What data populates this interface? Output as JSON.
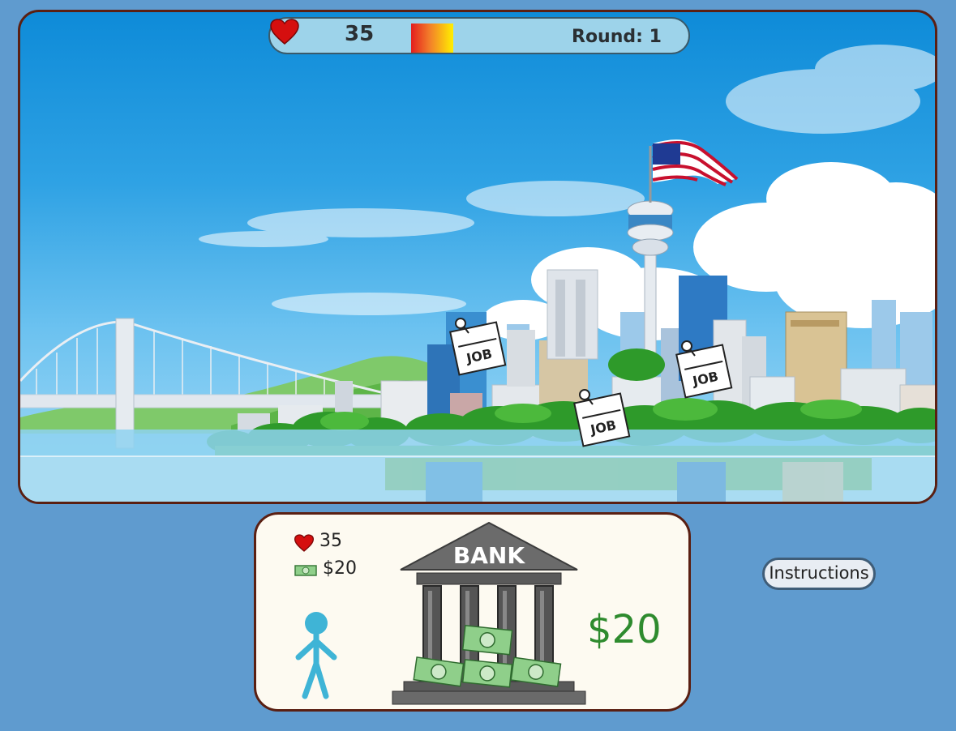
{
  "hud": {
    "health": "35",
    "round_label": "Round: 1"
  },
  "jobs": [
    {
      "label": "JOB"
    },
    {
      "label": "JOB"
    },
    {
      "label": "JOB"
    }
  ],
  "panel": {
    "health": "35",
    "money": "$20",
    "bank_label": "BANK",
    "balance": "$20"
  },
  "buttons": {
    "instructions": "Instructions"
  },
  "colors": {
    "frame": "#5a1f12",
    "background": "#5f9bcf",
    "balance": "#2e8b2e",
    "person": "#3fb4d6"
  },
  "icons": [
    "heart-icon",
    "cash-icon",
    "person-figure",
    "bank-building",
    "flag-icon",
    "pushpin-icon"
  ]
}
